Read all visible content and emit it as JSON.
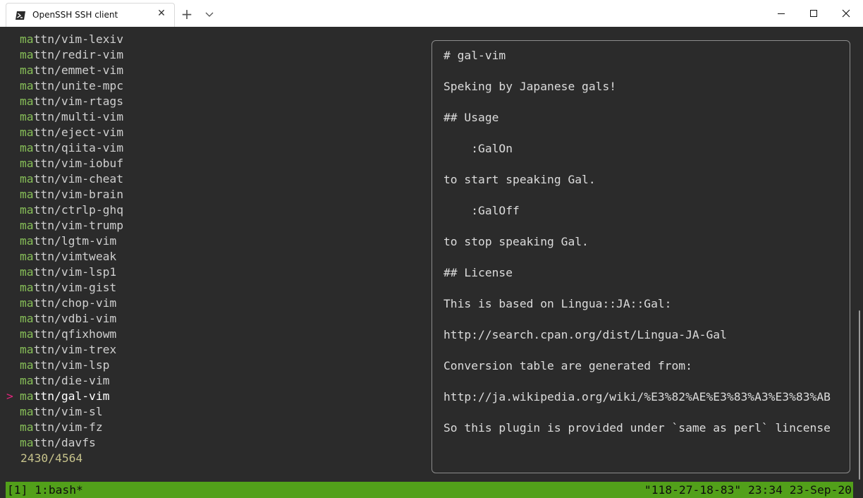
{
  "window": {
    "tab_title": "OpenSSH SSH client",
    "tab_icon": "powershell-prompt-icon",
    "close_tab_glyph": "✕",
    "new_tab_glyph": "+",
    "dropdown_icon": "chevron-down-icon",
    "minimize_icon": "minimize-icon",
    "maximize_icon": "maximize-icon",
    "close_icon": "close-icon"
  },
  "finder": {
    "pointer_glyph": ">",
    "selected_index": 23,
    "items": [
      {
        "match": "ma",
        "rest": "ttn/vim-lexiv"
      },
      {
        "match": "ma",
        "rest": "ttn/redir-vim"
      },
      {
        "match": "ma",
        "rest": "ttn/emmet-vim"
      },
      {
        "match": "ma",
        "rest": "ttn/unite-mpc"
      },
      {
        "match": "ma",
        "rest": "ttn/vim-rtags"
      },
      {
        "match": "ma",
        "rest": "ttn/multi-vim"
      },
      {
        "match": "ma",
        "rest": "ttn/eject-vim"
      },
      {
        "match": "ma",
        "rest": "ttn/qiita-vim"
      },
      {
        "match": "ma",
        "rest": "ttn/vim-iobuf"
      },
      {
        "match": "ma",
        "rest": "ttn/vim-cheat"
      },
      {
        "match": "ma",
        "rest": "ttn/vim-brain"
      },
      {
        "match": "ma",
        "rest": "ttn/ctrlp-ghq"
      },
      {
        "match": "ma",
        "rest": "ttn/vim-trump"
      },
      {
        "match": "ma",
        "rest": "ttn/lgtm-vim"
      },
      {
        "match": "ma",
        "rest": "ttn/vimtweak"
      },
      {
        "match": "ma",
        "rest": "ttn/vim-lsp1"
      },
      {
        "match": "ma",
        "rest": "ttn/vim-gist"
      },
      {
        "match": "ma",
        "rest": "ttn/chop-vim"
      },
      {
        "match": "ma",
        "rest": "ttn/vdbi-vim"
      },
      {
        "match": "ma",
        "rest": "ttn/qfixhowm"
      },
      {
        "match": "ma",
        "rest": "ttn/vim-trex"
      },
      {
        "match": "ma",
        "rest": "ttn/vim-lsp"
      },
      {
        "match": "ma",
        "rest": "ttn/die-vim"
      },
      {
        "match": "ma",
        "rest": "ttn/gal-vim"
      },
      {
        "match": "ma",
        "rest": "ttn/vim-sl"
      },
      {
        "match": "ma",
        "rest": "ttn/vim-fz"
      },
      {
        "match": "ma",
        "rest": "ttn/davfs"
      }
    ],
    "count": "2430/4564",
    "prompt": ">",
    "query": "ma"
  },
  "preview": {
    "lines": [
      "# gal-vim",
      "",
      "Speking by Japanese gals!",
      "",
      "## Usage",
      "",
      "    :GalOn",
      "",
      "to start speaking Gal.",
      "",
      "    :GalOff",
      "",
      "to stop speaking Gal.",
      "",
      "## License",
      "",
      "This is based on Lingua::JA::Gal:",
      "",
      "http://search.cpan.org/dist/Lingua-JA-Gal",
      "",
      "Conversion table are generated from:",
      "",
      "http://ja.wikipedia.org/wiki/%E3%82%AE%E3%83%A3%E3%83%AB",
      "",
      "So this plugin is provided under `same as perl` lincense"
    ]
  },
  "status": {
    "left": "[1] 1:bash*",
    "right": "\"118-27-18-83\" 23:34 23-Sep-20"
  },
  "colors": {
    "terminal_bg": "#2b2b2b",
    "match": "#87bf58",
    "pointer": "#e0267c",
    "count": "#c6c28b",
    "status_bg": "#52a01a",
    "cursor": "#55aaff"
  }
}
